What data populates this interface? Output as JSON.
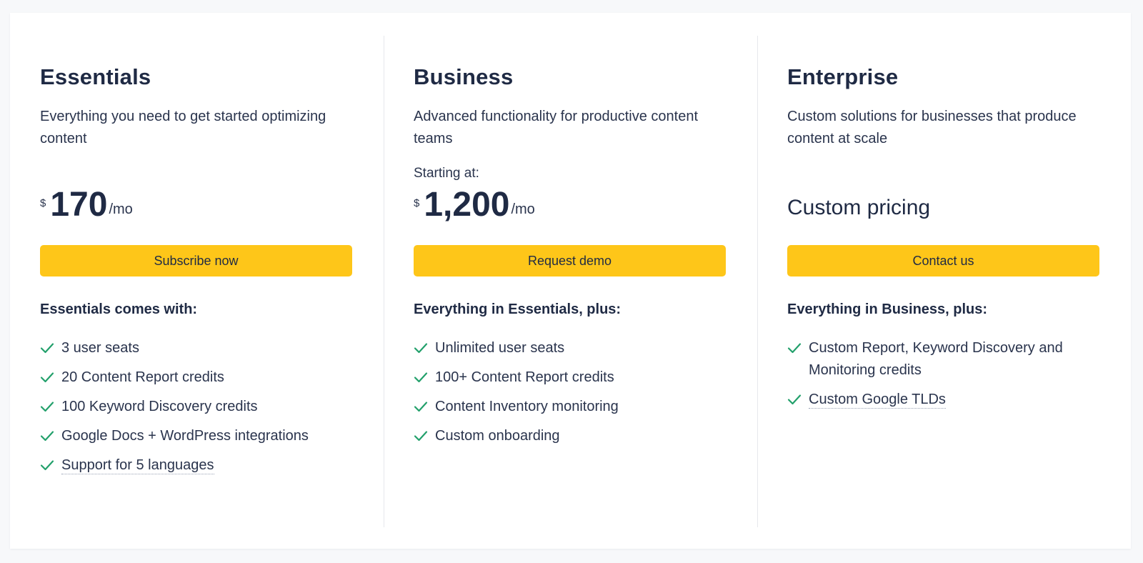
{
  "plans": [
    {
      "name": "Essentials",
      "description": "Everything you need to get started optimizing content",
      "currency": "$",
      "price": "170",
      "period": "/mo",
      "cta": "Subscribe now",
      "includes_heading": "Essentials comes with:",
      "features": [
        "3 user seats",
        "20 Content Report credits",
        "100 Keyword Discovery credits",
        "Google Docs + WordPress integrations",
        "Support for 5 languages"
      ]
    },
    {
      "name": "Business",
      "description": "Advanced functionality for productive content teams",
      "starting_at": "Starting at:",
      "currency": "$",
      "price": "1,200",
      "period": "/mo",
      "cta": "Request demo",
      "includes_heading": "Everything in Essentials, plus:",
      "features": [
        "Unlimited user seats",
        "100+ Content Report credits",
        "Content Inventory monitoring",
        "Custom onboarding"
      ]
    },
    {
      "name": "Enterprise",
      "description": "Custom solutions for businesses that produce content at scale",
      "custom_pricing": "Custom pricing",
      "cta": "Contact us",
      "includes_heading": "Everything in Business, plus:",
      "features": [
        "Custom Report, Keyword Discovery and Monitoring credits",
        "Custom Google TLDs"
      ]
    }
  ],
  "colors": {
    "accent": "#fec619",
    "check": "#22a06b",
    "text": "#1f2a44",
    "divider": "#e6e8ec"
  },
  "icons": {
    "feature": "check-icon"
  }
}
